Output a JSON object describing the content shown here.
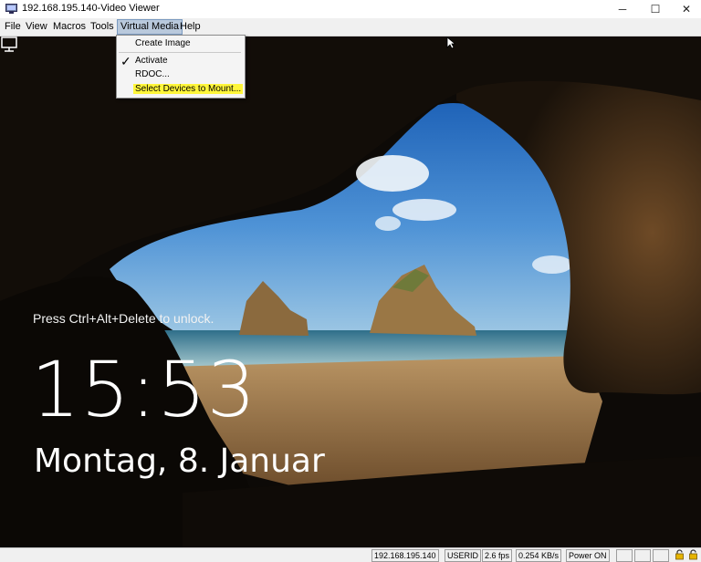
{
  "window": {
    "title": "192.168.195.140-Video Viewer",
    "controls": {
      "minimize": "─",
      "maximize": "☐",
      "close": "✕"
    }
  },
  "menubar": {
    "items": [
      "File",
      "View",
      "Macros",
      "Tools",
      "Virtual Media",
      "Help"
    ],
    "active": "Virtual Media"
  },
  "dropdown": {
    "items": [
      {
        "label": "Create Image",
        "checked": false,
        "highlighted": false
      },
      {
        "label": "Activate",
        "checked": true,
        "highlighted": false
      },
      {
        "label": "RDOC...",
        "checked": false,
        "highlighted": false
      },
      {
        "label": "Select Devices to Mount...",
        "checked": false,
        "highlighted": true
      }
    ],
    "check_glyph": "✓"
  },
  "lockscreen": {
    "hint": "Press Ctrl+Alt+Delete to unlock.",
    "time": "15:53",
    "date": "Montag, 8. Januar"
  },
  "statusbar": {
    "ip": "192.168.195.140",
    "user": "USERID",
    "fps": "2.6 fps",
    "rate": "0.254 KB/s",
    "power": "Power ON"
  },
  "icons": {
    "app": "monitor-icon",
    "network": "network-monitor-icon",
    "lock": "padlock-icon"
  },
  "colors": {
    "highlight": "#fff63a",
    "menu_active": "#b9c9dc"
  }
}
